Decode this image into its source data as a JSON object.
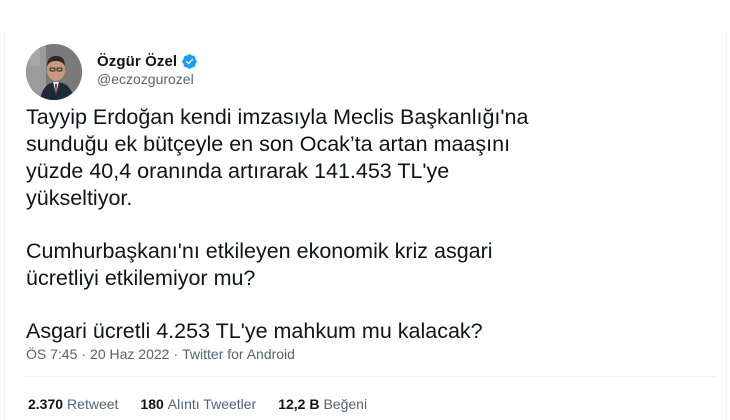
{
  "user": {
    "display_name": "Özgür Özel",
    "handle": "@eczozgurozel",
    "verified_icon": "verified-badge-icon",
    "verified_color": "#1d9bf0"
  },
  "tweet": {
    "paragraphs": [
      {
        "lines": [
          "Tayyip Erdoğan kendi imzasıyla Meclis Başkanlığı'na",
          "sunduğu ek bütçeyle en son Ocak’ta artan maaşını",
          "yüzde 40,4 oranında artırarak 141.453 TL'ye",
          "yükseltiyor."
        ]
      },
      {
        "lines": [
          "Cumhurbaşkanı'nı etkileyen ekonomik kriz asgari",
          "ücretliyi etkilemiyor mu?"
        ]
      },
      {
        "lines": [
          "Asgari ücretli 4.253 TL'ye mahkum mu kalacak?"
        ]
      }
    ]
  },
  "meta": {
    "time": "ÖS 7:45",
    "date": "20 Haz 2022",
    "source": "Twitter for Android",
    "separator": "·"
  },
  "stats": {
    "retweets": {
      "count": "2.370",
      "label": "Retweet"
    },
    "quotes": {
      "count": "180",
      "label": "Alıntı Tweetler"
    },
    "likes": {
      "count": "12,2 B",
      "label": "Beğeni"
    }
  },
  "colors": {
    "text": "#0f1419",
    "secondary": "#536471",
    "divider": "#eff3f4"
  }
}
